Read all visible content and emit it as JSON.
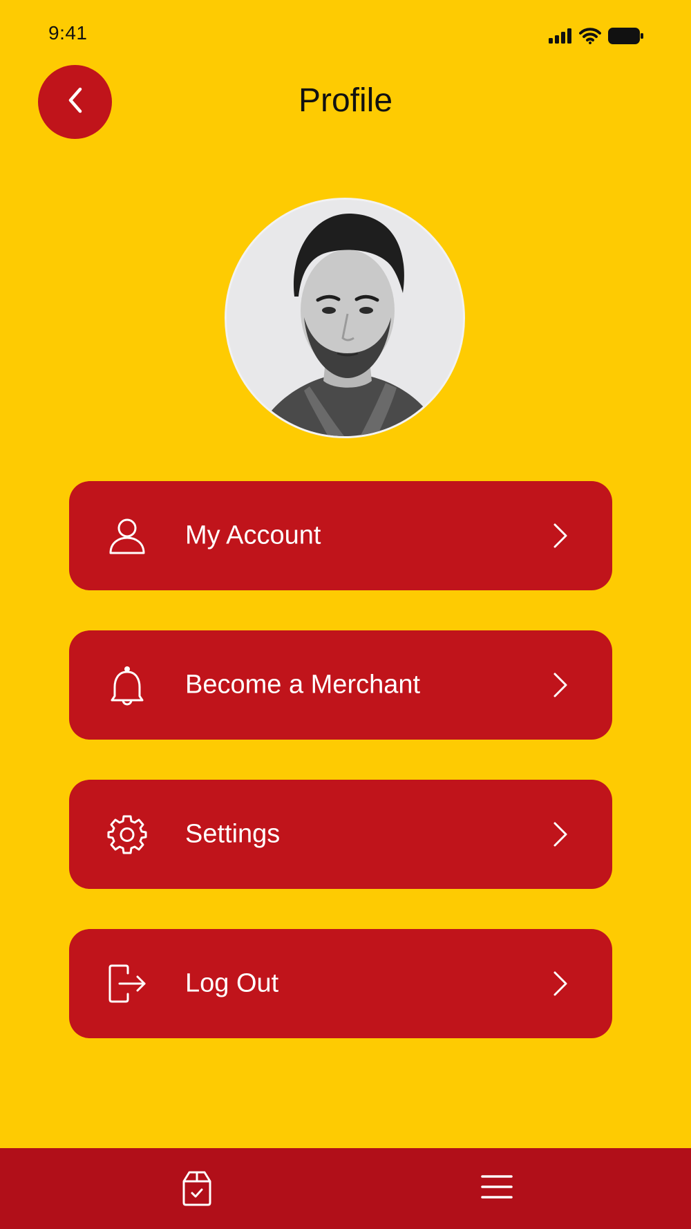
{
  "status_bar": {
    "time": "9:41",
    "icons": [
      "signal-icon",
      "wifi-icon",
      "battery-icon"
    ]
  },
  "header": {
    "title": "Profile",
    "back_icon": "chevron-left-icon"
  },
  "profile": {
    "avatar": "avatar-photo"
  },
  "menu": {
    "items": [
      {
        "label": "My Account",
        "icon": "user-icon"
      },
      {
        "label": "Become a Merchant",
        "icon": "bell-icon"
      },
      {
        "label": "Settings",
        "icon": "gear-icon"
      },
      {
        "label": "Log Out",
        "icon": "logout-icon"
      }
    ]
  },
  "bottom_nav": {
    "items": [
      {
        "icon": "package-check-icon"
      },
      {
        "icon": "hamburger-menu-icon"
      }
    ]
  },
  "colors": {
    "background": "#FECB02",
    "accent": "#C0141B",
    "bottom_bar": "#B10F19",
    "text_on_accent": "#FFFFFF"
  }
}
